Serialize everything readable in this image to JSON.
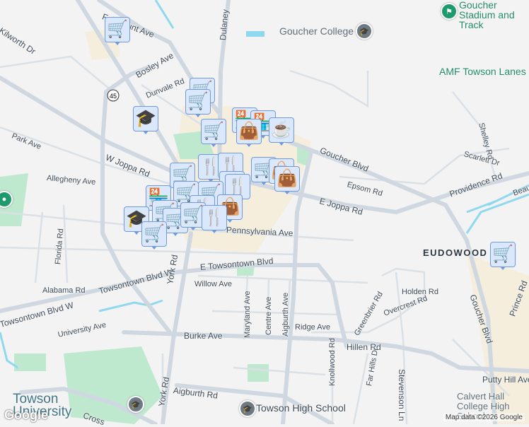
{
  "map": {
    "neighborhood": "EUDOWOOD",
    "attribution": "Map data ©2026 Google",
    "logo": "Google",
    "route_shield": "45",
    "colors": {
      "background": "#f4f3f4",
      "road": "#cfd8e0",
      "park": "#bfe9cf",
      "commercial": "#f5eedc",
      "water": "#8fd8ef",
      "marker_fill": "#dbe7fb",
      "marker_border": "#6f9ae0",
      "marker_icon": "#0c4266"
    },
    "streets": [
      "Fairmount Ave",
      "Kilworth Dr",
      "Bosley Ave",
      "Dunvale Rd",
      "York Rd",
      "Dulaney",
      "Park Ave",
      "W Joppa Rd",
      "Allegheny Ave",
      "Goucher Blvd",
      "E Joppa Rd",
      "Epsom Rd",
      "Providence Rd",
      "Scarlett Dr",
      "Shelley Rd",
      "Pennsylvania Ave",
      "Florida Rd",
      "Alabama Rd",
      "Towsontown Blvd W",
      "E Towsontown Blvd",
      "Willow Ave",
      "Maryland Ave",
      "Centre Ave",
      "Aigburth Ave",
      "Ridge Ave",
      "Burke Ave",
      "Hillen Rd",
      "University Ave",
      "Knollwood Rd",
      "Far Hills Dr",
      "Stevenson Ln",
      "Greenbrier Rd",
      "Holden Rd",
      "Overcrest Rd",
      "Goucher Blvd",
      "Prince Rd",
      "Putty Hill Ave",
      "Aigburth Rd",
      "York Rd",
      "Cross",
      "Beau"
    ],
    "places": {
      "goucher_college": "Goucher College",
      "goucher_stadium": "Goucher Stadium and Track",
      "amf": "AMF Towson Lanes",
      "towson_university": "Towson University",
      "towson_high": "Towson High School",
      "calvert_hall": "Calvert Hall College High School"
    },
    "markers": [
      "shopping-cart",
      "shopping-cart",
      "shopping-cart",
      "school",
      "shopping-cart",
      "store",
      "store",
      "shopping-bag",
      "coffee",
      "shopping-cart",
      "restaurant",
      "restaurant",
      "shopping-cart",
      "shopping-bag",
      "shopping-bag",
      "restaurant",
      "store",
      "shopping-cart",
      "shopping-cart",
      "restaurant",
      "shopping-cart",
      "restaurant",
      "shopping-bag",
      "school",
      "shopping-cart",
      "shopping-cart",
      "restaurant",
      "shopping-cart",
      "shopping-cart"
    ]
  }
}
